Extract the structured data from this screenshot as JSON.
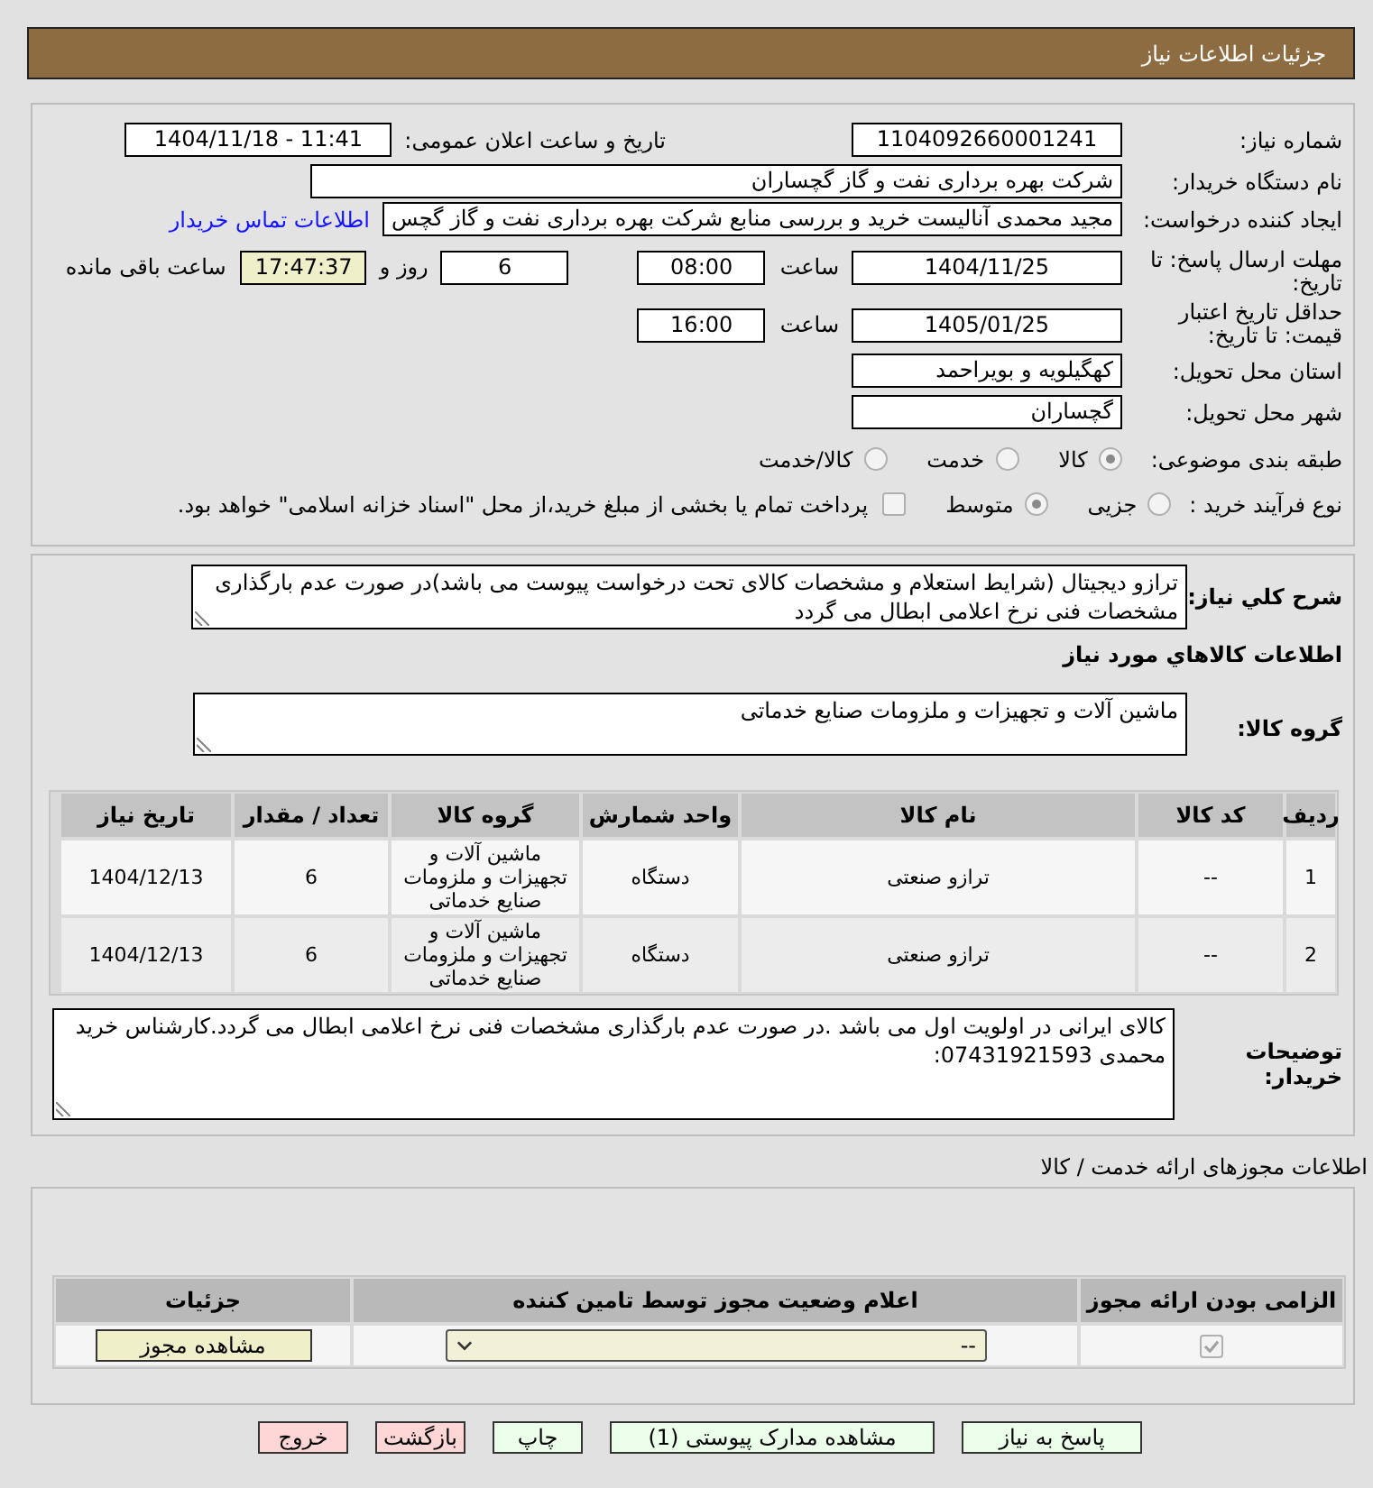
{
  "header": {
    "title": "جزئیات اطلاعات نیاز"
  },
  "details": {
    "need_number": {
      "label": "شماره نیاز:",
      "value": "1104092660001241"
    },
    "announce": {
      "label": "تاریخ و ساعت اعلان عمومی:",
      "value": "1404/11/18 - 11:41"
    },
    "buyer_org": {
      "label": "نام دستگاه خریدار:",
      "value": "شرکت بهره برداری نفت و گاز گچساران"
    },
    "requester": {
      "label": "ایجاد کننده درخواست:",
      "value": "مجید محمدی آنالیست خرید و بررسی منابع شرکت بهره برداری نفت و گاز گچس",
      "link": "اطلاعات تماس خریدار"
    },
    "reply_deadline": {
      "label": "مهلت ارسال پاسخ: تا تاریخ:",
      "date": "1404/11/25",
      "time_label": "ساعت",
      "time": "08:00",
      "days": "6",
      "days_label": "روز و",
      "remaining": "17:47:37",
      "remaining_label": "ساعت باقی مانده"
    },
    "price_validity": {
      "label": "حداقل تاریخ اعتبار قیمت: تا تاریخ:",
      "date": "1405/01/25",
      "time_label": "ساعت",
      "time": "16:00"
    },
    "province": {
      "label": "استان محل تحویل:",
      "value": "کهگیلویه و بویراحمد"
    },
    "city": {
      "label": "شهر محل تحویل:",
      "value": "گچساران"
    },
    "category": {
      "label": "طبقه بندی موضوعی:",
      "options": [
        {
          "label": "کالا",
          "selected": true
        },
        {
          "label": "خدمت",
          "selected": false
        },
        {
          "label": "کالا/خدمت",
          "selected": false
        }
      ]
    },
    "process": {
      "label": "نوع فرآیند خرید :",
      "options": [
        {
          "label": "جزیی",
          "selected": false
        },
        {
          "label": "متوسط",
          "selected": true
        }
      ],
      "treasury": {
        "label": "پرداخت تمام یا بخشی از مبلغ خرید،از محل \"اسناد خزانه اسلامی\" خواهد بود.",
        "checked": false
      }
    }
  },
  "need": {
    "description_label": "شرح كلي نياز:",
    "description": "ترازو دیجیتال (شرایط استعلام و مشخصات کالای تحت درخواست پیوست می باشد)در صورت عدم بارگذاری مشخصات فنی نرخ اعلامی ابطال می گردد",
    "items_title": "اطلاعات كالاهاي مورد نياز",
    "group_label": "گروه كالا:",
    "group": "ماشین آلات و تجهیزات و ملزومات صنایع خدماتی"
  },
  "items_table": {
    "columns": [
      "ردیف",
      "کد کالا",
      "نام کالا",
      "واحد شمارش",
      "گروه کالا",
      "تعداد / مقدار",
      "تاریخ نیاز"
    ],
    "rows": [
      [
        "1",
        "--",
        "ترازو صنعتی",
        "دستگاه",
        "ماشین آلات و تجهیزات و ملزومات صنایع خدماتی",
        "6",
        "1404/12/13"
      ],
      [
        "2",
        "--",
        "ترازو صنعتی",
        "دستگاه",
        "ماشین آلات و تجهیزات و ملزومات صنایع خدماتی",
        "6",
        "1404/12/13"
      ]
    ]
  },
  "notes": {
    "label": "توضیحات خریدار:",
    "text": "کالای ایرانی در اولویت اول می باشد .در صورت عدم بارگذاری مشخصات فنی نرخ اعلامی ابطال می گردد.کارشناس خرید محمدی 07431921593:"
  },
  "permits": {
    "title": "اطلاعات مجوزهای ارائه خدمت / کالا",
    "columns": [
      "الزامی بودن ارائه مجوز",
      "اعلام وضعیت مجوز توسط تامین کننده",
      "جزئیات"
    ],
    "rows": [
      {
        "required": true,
        "status": "--",
        "action": "مشاهده مجوز"
      }
    ]
  },
  "buttons": [
    {
      "label": "پاسخ به نیاز",
      "kind": "action"
    },
    {
      "label": "مشاهده مدارک پیوستی (1)",
      "kind": "action"
    },
    {
      "label": "چاپ",
      "kind": "action"
    },
    {
      "label": "بازگشت",
      "kind": "exit"
    },
    {
      "label": "خروج",
      "kind": "exit"
    }
  ]
}
